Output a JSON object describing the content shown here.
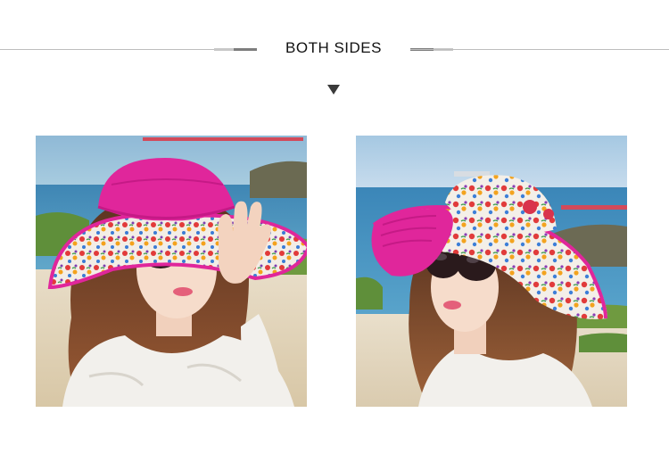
{
  "header": {
    "title": "BOTH SIDES",
    "arrow_icon": "down-triangle-icon"
  },
  "photos": [
    {
      "label": "model-pink-side-out",
      "hat_color": "#e0269b"
    },
    {
      "label": "model-floral-side-out",
      "hat_color": "#e0269b"
    }
  ]
}
